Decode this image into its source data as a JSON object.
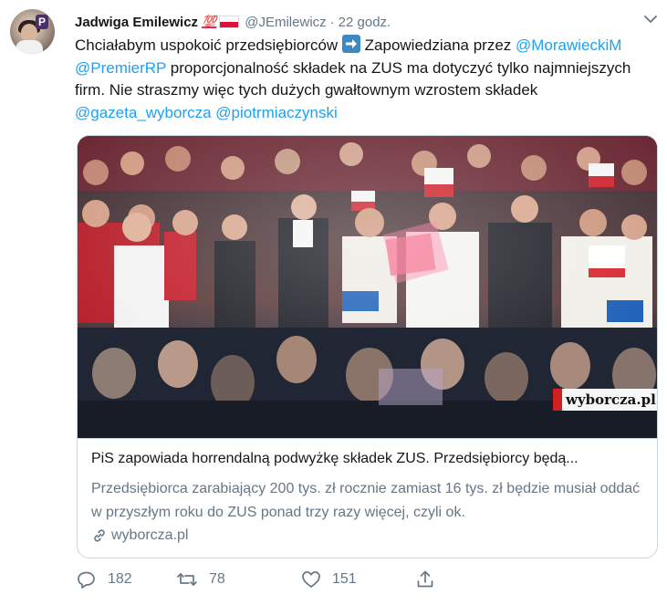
{
  "author": {
    "name": "Jadwiga Emilewicz",
    "badge_emoji": "💯",
    "handle": "@JEmilewicz",
    "separator": "·",
    "time": "22 godz."
  },
  "tweet": {
    "part1": "Chciałabym uspokoić przedsiębiorców ",
    "part2": " Zapowiedziana przez ",
    "mention1": "@MorawieckiM",
    "space1": " ",
    "mention2": "@PremierRP",
    "part3": " proporcjonalność składek na ZUS ma dotyczyć tylko najmniejszych firm. Nie straszmy więc tych dużych gwałtownym wzrostem składek ",
    "mention3": "@gazeta_wyborcza",
    "space2": " ",
    "mention4": "@piotrmiaczynski"
  },
  "card": {
    "watermark": "wyborcza.pl",
    "title": "PiS zapowiada horrendalną podwyżkę składek ZUS. Przedsiębiorcy będą...",
    "description": "Przedsiębiorca zarabiający 200 tys. zł rocznie zamiast 16 tys. zł będzie musiał oddać w przyszłym roku do ZUS ponad trzy razy więcej, czyli ok.",
    "source": "wyborcza.pl"
  },
  "actions": {
    "replies": "182",
    "retweets": "78",
    "likes": "151"
  },
  "icons": [
    "chevron-down-icon",
    "arrow-right-emoji-icon",
    "link-icon",
    "reply-icon",
    "retweet-icon",
    "like-icon",
    "share-icon"
  ],
  "colors": {
    "link": "#1da1f2",
    "muted": "#657786",
    "border": "#ccd6dd",
    "text": "#14171a"
  }
}
